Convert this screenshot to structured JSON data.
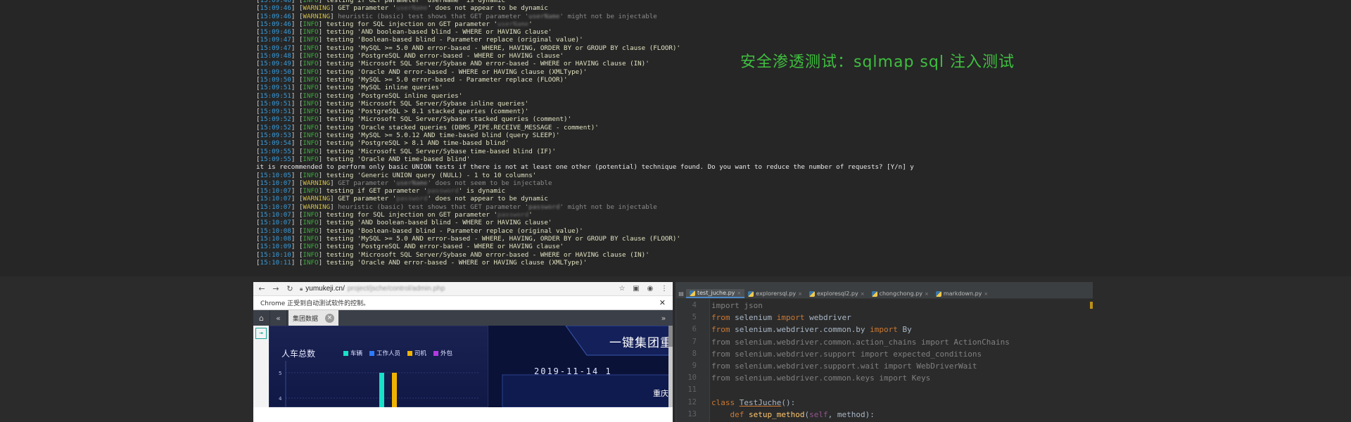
{
  "terminal": {
    "lines": [
      {
        "time": "15:09:46",
        "level": "INFO",
        "message": "testing if GET parameter 'userName' is dynamic"
      },
      {
        "time": "15:09:46",
        "level": "WARNING",
        "parts": [
          "GET parameter '",
          "userName",
          "' does not appear to be dynamic"
        ]
      },
      {
        "time": "15:09:46",
        "level": "WARNING",
        "dim": true,
        "parts": [
          "heuristic (basic) test shows that GET parameter '",
          "userName",
          "' might not be injectable"
        ]
      },
      {
        "time": "15:09:46",
        "level": "INFO",
        "parts": [
          "testing for SQL injection on GET parameter '",
          "userName",
          "'"
        ]
      },
      {
        "time": "15:09:46",
        "level": "INFO",
        "message": "testing 'AND boolean-based blind - WHERE or HAVING clause'"
      },
      {
        "time": "15:09:47",
        "level": "INFO",
        "message": "testing 'Boolean-based blind - Parameter replace (original value)'"
      },
      {
        "time": "15:09:47",
        "level": "INFO",
        "message": "testing 'MySQL >= 5.0 AND error-based - WHERE, HAVING, ORDER BY or GROUP BY clause (FLOOR)'"
      },
      {
        "time": "15:09:48",
        "level": "INFO",
        "message": "testing 'PostgreSQL AND error-based - WHERE or HAVING clause'"
      },
      {
        "time": "15:09:49",
        "level": "INFO",
        "message": "testing 'Microsoft SQL Server/Sybase AND error-based - WHERE or HAVING clause (IN)'"
      },
      {
        "time": "15:09:50",
        "level": "INFO",
        "message": "testing 'Oracle AND error-based - WHERE or HAVING clause (XMLType)'"
      },
      {
        "time": "15:09:50",
        "level": "INFO",
        "message": "testing 'MySQL >= 5.0 error-based - Parameter replace (FLOOR)'"
      },
      {
        "time": "15:09:51",
        "level": "INFO",
        "message": "testing 'MySQL inline queries'"
      },
      {
        "time": "15:09:51",
        "level": "INFO",
        "message": "testing 'PostgreSQL inline queries'"
      },
      {
        "time": "15:09:51",
        "level": "INFO",
        "message": "testing 'Microsoft SQL Server/Sybase inline queries'"
      },
      {
        "time": "15:09:51",
        "level": "INFO",
        "message": "testing 'PostgreSQL > 8.1 stacked queries (comment)'"
      },
      {
        "time": "15:09:52",
        "level": "INFO",
        "message": "testing 'Microsoft SQL Server/Sybase stacked queries (comment)'"
      },
      {
        "time": "15:09:52",
        "level": "INFO",
        "message": "testing 'Oracle stacked queries (DBMS_PIPE.RECEIVE_MESSAGE - comment)'"
      },
      {
        "time": "15:09:53",
        "level": "INFO",
        "message": "testing 'MySQL >= 5.0.12 AND time-based blind (query SLEEP)'"
      },
      {
        "time": "15:09:54",
        "level": "INFO",
        "message": "testing 'PostgreSQL > 8.1 AND time-based blind'"
      },
      {
        "time": "15:09:55",
        "level": "INFO",
        "message": "testing 'Microsoft SQL Server/Sybase time-based blind (IF)'"
      },
      {
        "time": "15:09:55",
        "level": "INFO",
        "message": "testing 'Oracle AND time-based blind'"
      },
      {
        "plain": "it is recommended to perform only basic UNION tests if there is not at least one other (potential) technique found. Do you want to reduce the number of requests? [Y/n] y"
      },
      {
        "time": "15:10:05",
        "level": "INFO",
        "message": "testing 'Generic UNION query (NULL) - 1 to 10 columns'"
      },
      {
        "time": "15:10:07",
        "level": "WARNING",
        "dim": true,
        "parts": [
          "GET parameter '",
          "userName",
          "' does not seem to be injectable"
        ]
      },
      {
        "time": "15:10:07",
        "level": "INFO",
        "parts": [
          "testing if GET parameter '",
          "password",
          "' is dynamic"
        ]
      },
      {
        "time": "15:10:07",
        "level": "WARNING",
        "parts": [
          "GET parameter '",
          "password",
          "' does not appear to be dynamic"
        ]
      },
      {
        "time": "15:10:07",
        "level": "WARNING",
        "dim": true,
        "parts": [
          "heuristic (basic) test shows that GET parameter '",
          "password",
          "' might not be injectable"
        ]
      },
      {
        "time": "15:10:07",
        "level": "INFO",
        "parts": [
          "testing for SQL injection on GET parameter '",
          "password",
          "'"
        ]
      },
      {
        "time": "15:10:07",
        "level": "INFO",
        "message": "testing 'AND boolean-based blind - WHERE or HAVING clause'"
      },
      {
        "time": "15:10:08",
        "level": "INFO",
        "message": "testing 'Boolean-based blind - Parameter replace (original value)'"
      },
      {
        "time": "15:10:08",
        "level": "INFO",
        "message": "testing 'MySQL >= 5.0 AND error-based - WHERE, HAVING, ORDER BY or GROUP BY clause (FLOOR)'"
      },
      {
        "time": "15:10:09",
        "level": "INFO",
        "message": "testing 'PostgreSQL AND error-based - WHERE or HAVING clause'"
      },
      {
        "time": "15:10:10",
        "level": "INFO",
        "message": "testing 'Microsoft SQL Server/Sybase AND error-based - WHERE or HAVING clause (IN)'"
      },
      {
        "time": "15:10:11",
        "level": "INFO",
        "message": "testing 'Oracle AND error-based - WHERE or HAVING clause (XMLType)'"
      }
    ],
    "overlay_title": "安全渗透测试：sqlmap sql 注入测试"
  },
  "browser": {
    "back_icon": "arrow-left-icon",
    "forward_icon": "arrow-right-icon",
    "reload_icon": "reload-icon",
    "lock_icon": "lock-icon",
    "url_host": "yumukeji.cn/",
    "url_path": "project/jsche/control/admin.php",
    "star_icon": "star-icon",
    "infobar_text": "Chrome 正受到自动测试软件的控制。",
    "app": {
      "home_icon": "home-icon",
      "prev_icon": "double-chevron-left-icon",
      "tab_label": "集团数据",
      "next_icon": "double-chevron-right-icon",
      "headline": "一键集团重",
      "date": "2019-11-14 1",
      "city": "重庆",
      "chart_data": {
        "type": "bar",
        "title": "人车总数",
        "series": [
          {
            "name": "车辆",
            "color": "#19e0c6"
          },
          {
            "name": "工作人员",
            "color": "#2e7bff"
          },
          {
            "name": "司机",
            "color": "#f0b400"
          },
          {
            "name": "外包",
            "color": "#b23ae0"
          }
        ],
        "yticks": [
          "5",
          "4"
        ],
        "visible_bars": [
          {
            "series": "车辆",
            "value": 5
          },
          {
            "series": "司机",
            "value": 5
          }
        ]
      }
    }
  },
  "ide": {
    "tabs": [
      {
        "label": "test_juche.py",
        "active": true
      },
      {
        "label": "explorersql.py",
        "active": false
      },
      {
        "label": "exploresql2.py",
        "active": false
      },
      {
        "label": "chongchong.py",
        "active": false
      },
      {
        "label": "markdown.py",
        "active": false
      }
    ],
    "lines": [
      {
        "n": "4",
        "text": "import json"
      },
      {
        "n": "5",
        "text": "from selenium import webdriver"
      },
      {
        "n": "6",
        "text": "from selenium.webdriver.common.by import By"
      },
      {
        "n": "7",
        "text": "from selenium.webdriver.common.action_chains import ActionChains"
      },
      {
        "n": "8",
        "text": "from selenium.webdriver.support import expected_conditions"
      },
      {
        "n": "9",
        "text": "from selenium.webdriver.support.wait import WebDriverWait"
      },
      {
        "n": "10",
        "text": "from selenium.webdriver.common.keys import Keys"
      },
      {
        "n": "11",
        "text": ""
      },
      {
        "n": "12",
        "text": "class TestJuche():"
      },
      {
        "n": "13",
        "text": "    def setup_method(self, method):"
      }
    ]
  }
}
